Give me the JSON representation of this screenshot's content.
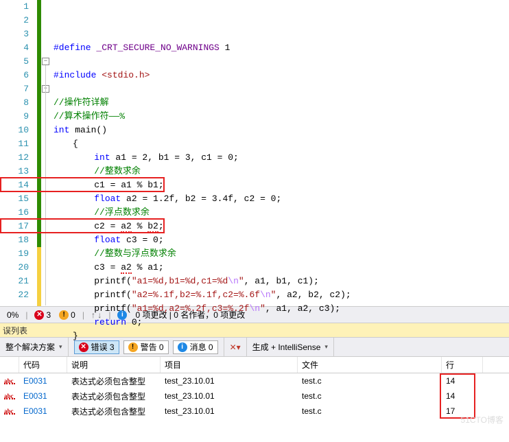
{
  "lines": [
    {
      "n": 1,
      "tokens": [
        [
          "kw",
          "#define"
        ],
        [
          "txt",
          " "
        ],
        [
          "mac",
          "_CRT_SECURE_NO_WARNINGS"
        ],
        [
          "txt",
          " 1"
        ]
      ]
    },
    {
      "n": 2,
      "tokens": []
    },
    {
      "n": 3,
      "tokens": [
        [
          "kw",
          "#include"
        ],
        [
          "txt",
          " "
        ],
        [
          "str",
          "<stdio.h>"
        ]
      ]
    },
    {
      "n": 4,
      "tokens": []
    },
    {
      "n": 5,
      "tokens": [
        [
          "cmt",
          "//操作符详解"
        ]
      ]
    },
    {
      "n": 6,
      "tokens": [
        [
          "cmt",
          "//算术操作符——%"
        ]
      ]
    },
    {
      "n": 7,
      "tokens": [
        [
          "kw",
          "int"
        ],
        [
          "txt",
          " main()"
        ]
      ]
    },
    {
      "n": 8,
      "tokens": [
        [
          "txt",
          "{"
        ]
      ]
    },
    {
      "n": 9,
      "tokens": [
        [
          "txt",
          "    "
        ],
        [
          "kw",
          "int"
        ],
        [
          "txt",
          " a1 = 2, b1 = 3, c1 = 0;"
        ]
      ]
    },
    {
      "n": 10,
      "tokens": [
        [
          "txt",
          "    "
        ],
        [
          "cmt",
          "//整数求余"
        ]
      ]
    },
    {
      "n": 11,
      "tokens": [
        [
          "txt",
          "    c1 = a1 % b1;"
        ]
      ]
    },
    {
      "n": 12,
      "tokens": [
        [
          "txt",
          "    "
        ],
        [
          "kw",
          "float"
        ],
        [
          "txt",
          " a2 = 1.2f, b2 = 3.4f, c2 = 0;"
        ]
      ]
    },
    {
      "n": 13,
      "tokens": [
        [
          "txt",
          "    "
        ],
        [
          "cmt",
          "//浮点数求余"
        ]
      ]
    },
    {
      "n": 14,
      "tokens": [
        [
          "txt",
          "    c2 = "
        ],
        [
          "sq",
          "a2"
        ],
        [
          "txt",
          " % "
        ],
        [
          "sq",
          "b2"
        ],
        [
          "txt",
          ";"
        ]
      ]
    },
    {
      "n": 15,
      "tokens": [
        [
          "txt",
          "    "
        ],
        [
          "kw",
          "float"
        ],
        [
          "txt",
          " c3 = 0;"
        ]
      ]
    },
    {
      "n": 16,
      "tokens": [
        [
          "txt",
          "    "
        ],
        [
          "cmt",
          "//整数与浮点数求余"
        ]
      ]
    },
    {
      "n": 17,
      "tokens": [
        [
          "txt",
          "    c3 = "
        ],
        [
          "sq",
          "a2"
        ],
        [
          "txt",
          " % a1;"
        ]
      ]
    },
    {
      "n": 18,
      "tokens": [
        [
          "txt",
          "    printf("
        ],
        [
          "str",
          "\"a1=%d,b1=%d,c1=%d"
        ],
        [
          "esc",
          "\\n"
        ],
        [
          "str",
          "\""
        ],
        [
          "txt",
          ", a1, b1, c1);"
        ]
      ]
    },
    {
      "n": 19,
      "tokens": [
        [
          "txt",
          "    printf("
        ],
        [
          "str",
          "\"a2=%.1f,b2=%.1f,c2=%.6f"
        ],
        [
          "esc",
          "\\n"
        ],
        [
          "str",
          "\""
        ],
        [
          "txt",
          ", a2, b2, c2);"
        ]
      ]
    },
    {
      "n": 20,
      "tokens": [
        [
          "txt",
          "    printf("
        ],
        [
          "str",
          "\"a1=%d,a2=%.2f,c3=%.2f"
        ],
        [
          "esc",
          "\\n"
        ],
        [
          "str",
          "\""
        ],
        [
          "txt",
          ", a1, a2, c3);"
        ]
      ]
    },
    {
      "n": 21,
      "tokens": [
        [
          "txt",
          "    "
        ],
        [
          "kw",
          "return"
        ],
        [
          "txt",
          " 0;"
        ]
      ]
    },
    {
      "n": 22,
      "tokens": [
        [
          "txt",
          "}"
        ]
      ]
    }
  ],
  "status": {
    "pct": "0%",
    "err": "3",
    "warn": "0",
    "arrows": "↑ ↓",
    "changes": "0 项更改 | 0 名作者，0 项更改"
  },
  "errlist_title": "误列表",
  "filter": {
    "scope": "整个解决方案",
    "errors": "错误 3",
    "warnings": "警告 0",
    "messages": "消息 0",
    "build": "生成 + IntelliSense"
  },
  "grid": {
    "headers": {
      "code": "代码",
      "desc": "说明",
      "proj": "项目",
      "file": "文件",
      "line": "行"
    },
    "rows": [
      {
        "code": "E0031",
        "desc": "表达式必须包含整型",
        "proj": "test_23.10.01",
        "file": "test.c",
        "line": "14"
      },
      {
        "code": "E0031",
        "desc": "表达式必须包含整型",
        "proj": "test_23.10.01",
        "file": "test.c",
        "line": "14"
      },
      {
        "code": "E0031",
        "desc": "表达式必须包含整型",
        "proj": "test_23.10.01",
        "file": "test.c",
        "line": "17"
      }
    ]
  },
  "watermark": "51CTO博客"
}
